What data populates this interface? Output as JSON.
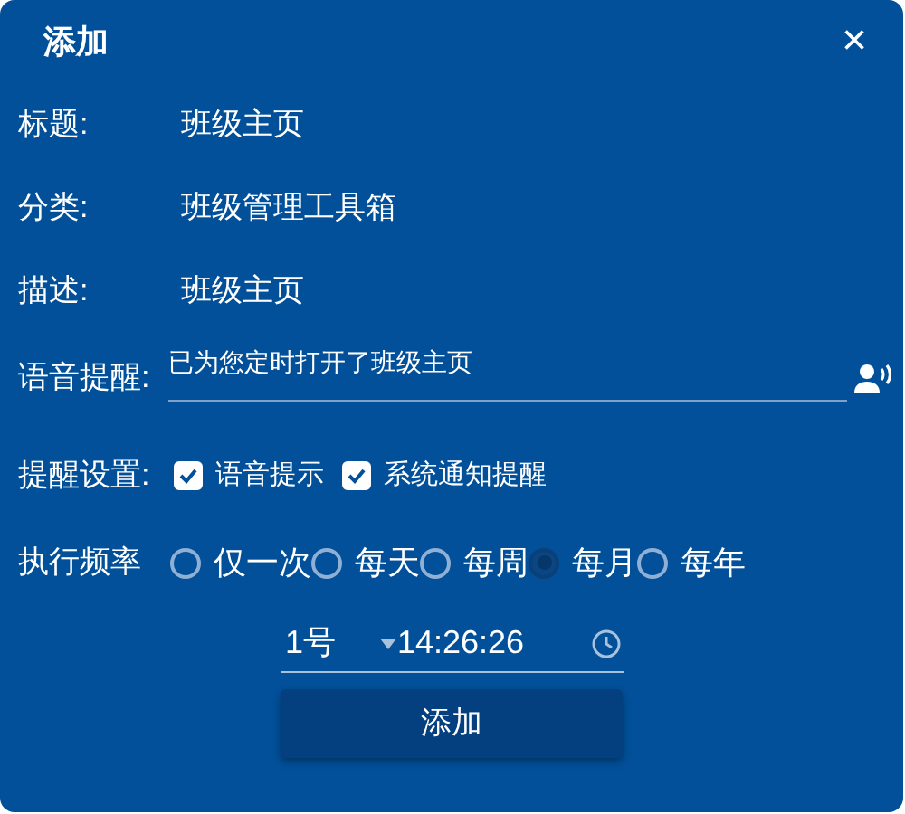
{
  "dialog": {
    "title": "添加",
    "close": "×"
  },
  "fields": [
    {
      "label": "标题:",
      "value": "班级主页"
    },
    {
      "label": "分类:",
      "value": "班级管理工具箱"
    },
    {
      "label": "描述:",
      "value": "班级主页"
    }
  ],
  "voice": {
    "label": "语音提醒:",
    "value": "已为您定时打开了班级主页"
  },
  "settings": {
    "label": "提醒设置:",
    "options": [
      {
        "label": "语音提示",
        "checked": true
      },
      {
        "label": "系统通知提醒",
        "checked": true
      }
    ]
  },
  "frequency": {
    "label": "执行频率",
    "options": [
      {
        "label": "仅一次",
        "selected": false
      },
      {
        "label": "每天",
        "selected": false
      },
      {
        "label": "每周",
        "selected": false
      },
      {
        "label": "每月",
        "selected": true
      },
      {
        "label": "每年",
        "selected": false
      }
    ]
  },
  "schedule": {
    "day": "1号",
    "time": "14:26:26"
  },
  "submit": "添加"
}
